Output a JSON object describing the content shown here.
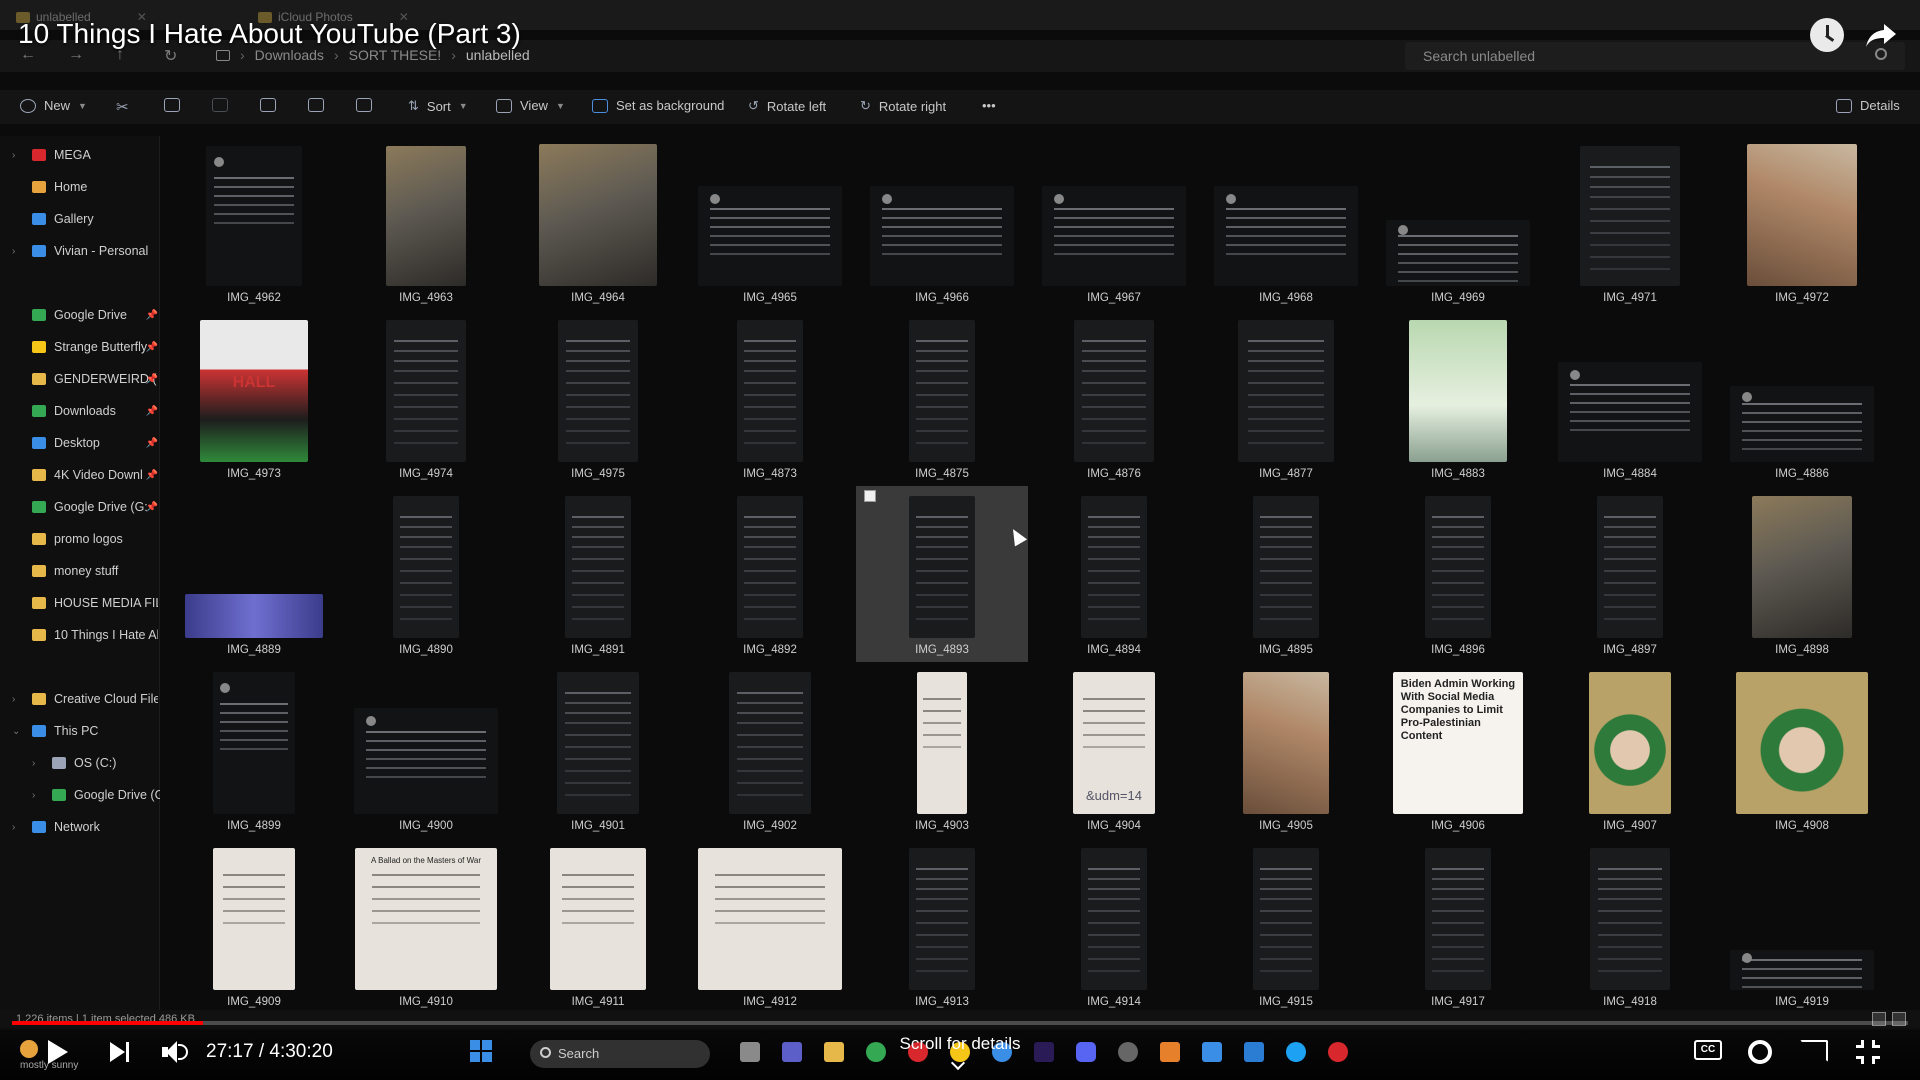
{
  "video": {
    "title": "10 Things I Hate About YouTube (Part 3)",
    "current_time": "27:17",
    "duration": "4:30:20",
    "time_display": "27:17 / 4:30:20",
    "progress_fraction": 0.1008,
    "scroll_hint": "Scroll for details",
    "buttons": {
      "cc": "CC"
    },
    "colors": {
      "progress": "#ff0000"
    }
  },
  "explorer": {
    "tabs": [
      {
        "label": "unlabelled"
      },
      {
        "label": "iCloud Photos"
      }
    ],
    "breadcrumb": [
      "Downloads",
      "SORT THESE!",
      "unlabelled"
    ],
    "search_placeholder": "Search unlabelled",
    "toolbar": {
      "new": "New",
      "sort": "Sort",
      "view": "View",
      "set_background": "Set as background",
      "rotate_left": "Rotate left",
      "rotate_right": "Rotate right",
      "more": "•••",
      "details": "Details"
    },
    "sidebar": [
      {
        "label": "MEGA",
        "icon": "mega-icon",
        "color": "#d9272e"
      },
      {
        "label": "Home",
        "icon": "home-icon",
        "color": "#e6a23c"
      },
      {
        "label": "Gallery",
        "icon": "gallery-icon",
        "color": "#3a8ee6"
      },
      {
        "label": "Vivian - Personal",
        "icon": "cloud-icon",
        "color": "#3a8ee6"
      },
      {
        "label": "Google Drive",
        "icon": "google-drive-icon",
        "color": "#34a853"
      },
      {
        "label": "Strange Butterfly",
        "icon": "star-icon",
        "color": "#f5c518"
      },
      {
        "label": "GENDERWEIRD (",
        "icon": "folder-icon",
        "color": "#e6b84a"
      },
      {
        "label": "Downloads",
        "icon": "download-icon",
        "color": "#34a853"
      },
      {
        "label": "Desktop",
        "icon": "desktop-icon",
        "color": "#3a8ee6"
      },
      {
        "label": "4K Video Downl",
        "icon": "folder-icon",
        "color": "#e6b84a"
      },
      {
        "label": "Google Drive (G:",
        "icon": "google-drive-icon",
        "color": "#34a853"
      },
      {
        "label": "promo logos",
        "icon": "folder-icon",
        "color": "#e6b84a"
      },
      {
        "label": "money stuff",
        "icon": "folder-icon",
        "color": "#e6b84a"
      },
      {
        "label": "HOUSE MEDIA FILE",
        "icon": "folder-icon",
        "color": "#e6b84a"
      },
      {
        "label": "10 Things I Hate Ab",
        "icon": "folder-icon",
        "color": "#e6b84a"
      },
      {
        "label": "Creative Cloud File",
        "icon": "folder-icon",
        "color": "#e6b84a"
      },
      {
        "label": "This PC",
        "icon": "computer-icon",
        "color": "#3a8ee6"
      },
      {
        "label": "OS (C:)",
        "icon": "drive-icon",
        "color": "#9aa4b6"
      },
      {
        "label": "Google Drive (G:)",
        "icon": "google-drive-icon",
        "color": "#34a853"
      },
      {
        "label": "Network",
        "icon": "network-icon",
        "color": "#3a8ee6"
      }
    ],
    "files": [
      [
        "IMG_4962",
        "IMG_4963",
        "IMG_4964",
        "IMG_4965",
        "IMG_4966",
        "IMG_4967",
        "IMG_4968",
        "IMG_4969",
        "IMG_4971",
        "IMG_4972"
      ],
      [
        "IMG_4973",
        "IMG_4974",
        "IMG_4975",
        "IMG_4873",
        "IMG_4875",
        "IMG_4876",
        "IMG_4877",
        "IMG_4883",
        "IMG_4884",
        "IMG_4886"
      ],
      [
        "IMG_4889",
        "IMG_4890",
        "IMG_4891",
        "IMG_4892",
        "IMG_4893",
        "IMG_4894",
        "IMG_4895",
        "IMG_4896",
        "IMG_4897",
        "IMG_4898"
      ],
      [
        "IMG_4899",
        "IMG_4900",
        "IMG_4901",
        "IMG_4902",
        "IMG_4903",
        "IMG_4904",
        "IMG_4905",
        "IMG_4906",
        "IMG_4907",
        "IMG_4908"
      ],
      [
        "IMG_4909",
        "IMG_4910",
        "IMG_4911",
        "IMG_4912",
        "IMG_4913",
        "IMG_4914",
        "IMG_4915",
        "IMG_4917",
        "IMG_4918",
        "IMG_4919"
      ]
    ],
    "thumb_captions": {
      "IMG_4906": "Biden Admin Working With Social Media Companies to Limit Pro-Palestinian Content",
      "IMG_4904": "&udm=14",
      "IMG_4910": "A Ballad on the Masters of War",
      "IMG_4973": "HALL"
    },
    "selected_file": "IMG_4893",
    "status": "1,226 items | 1 item selected 486 KB"
  },
  "taskbar": {
    "search_label": "Search",
    "weather_text": "mostly sunny"
  }
}
